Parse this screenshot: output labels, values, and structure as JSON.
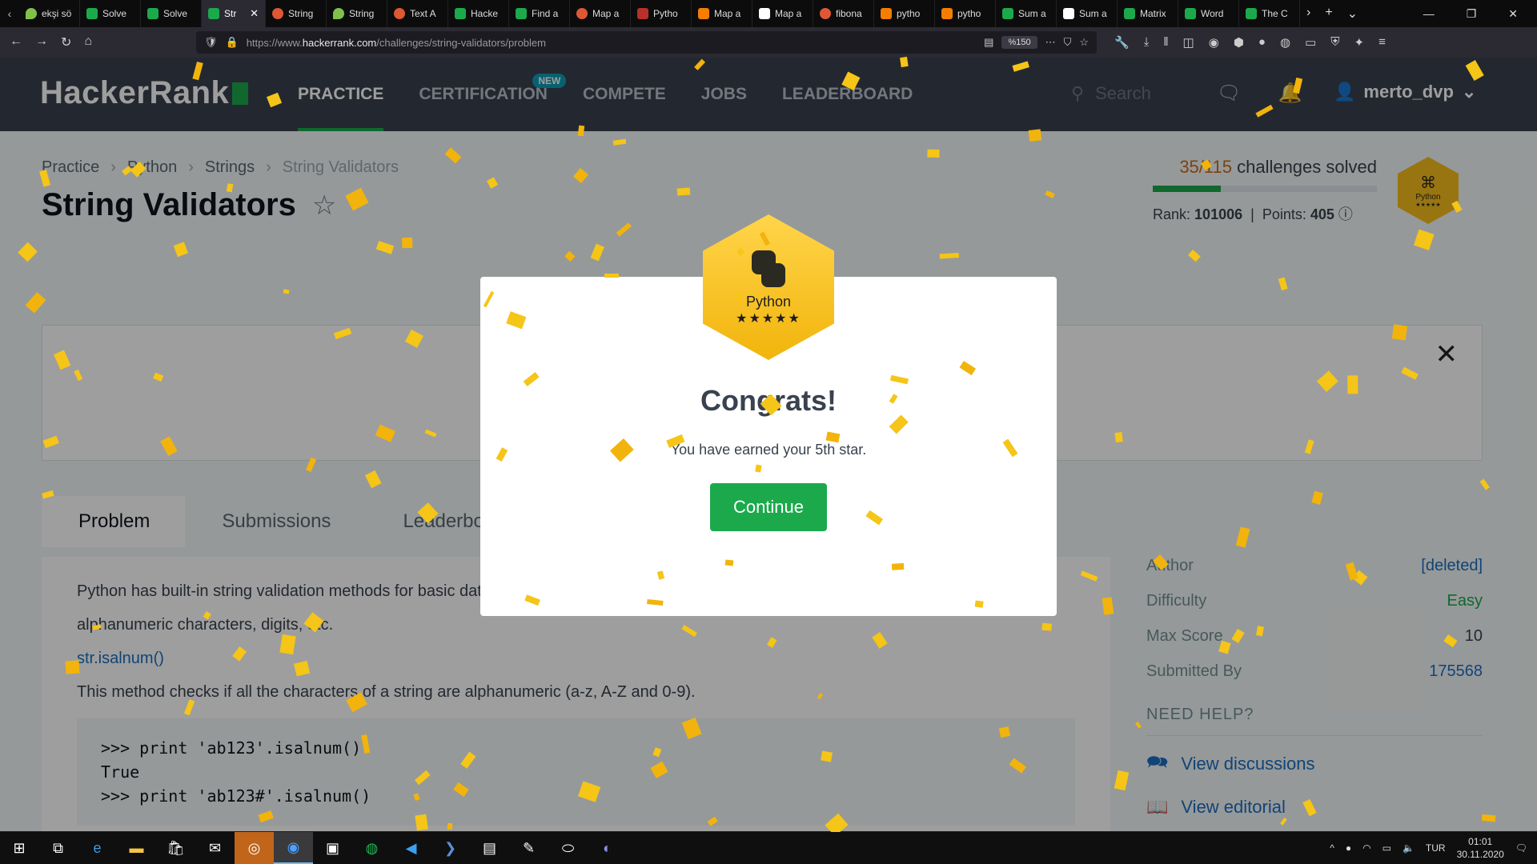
{
  "browser": {
    "tabs": [
      {
        "title": "ekşi sö",
        "icon": "ek"
      },
      {
        "title": "Solve",
        "icon": "hr"
      },
      {
        "title": "Solve",
        "icon": "hr"
      },
      {
        "title": "Str",
        "icon": "hr",
        "active": true
      },
      {
        "title": "String",
        "icon": "dd"
      },
      {
        "title": "String",
        "icon": "ek"
      },
      {
        "title": "Text A",
        "icon": "dd"
      },
      {
        "title": "Hacke",
        "icon": "hr"
      },
      {
        "title": "Find a",
        "icon": "hr"
      },
      {
        "title": "Map a",
        "icon": "dd"
      },
      {
        "title": "Pytho",
        "icon": "rd"
      },
      {
        "title": "Map a",
        "icon": "bl"
      },
      {
        "title": "Map a",
        "icon": "wh"
      },
      {
        "title": "fibona",
        "icon": "dd"
      },
      {
        "title": "pytho",
        "icon": "bl"
      },
      {
        "title": "pytho",
        "icon": "bl"
      },
      {
        "title": "Sum a",
        "icon": "hr"
      },
      {
        "title": "Sum a",
        "icon": "wh"
      },
      {
        "title": "Matrix",
        "icon": "hr"
      },
      {
        "title": "Word",
        "icon": "hr"
      },
      {
        "title": "The C",
        "icon": "hr"
      }
    ],
    "url_prefix": "https://www.",
    "url_domain": "hackerrank.com",
    "url_path": "/challenges/string-validators/problem",
    "zoom": "%150"
  },
  "header": {
    "logo": "HackerRank",
    "nav": [
      "PRACTICE",
      "CERTIFICATION",
      "COMPETE",
      "JOBS",
      "LEADERBOARD"
    ],
    "new_badge": "NEW",
    "search_placeholder": "Search",
    "username": "merto_dvp"
  },
  "breadcrumb": [
    "Practice",
    "Python",
    "Strings",
    "String Validators"
  ],
  "title": "String Validators",
  "stats": {
    "solved_count": "35/115",
    "solved_label": "challenges solved",
    "progress": 0.304,
    "rank_label": "Rank:",
    "rank": "101006",
    "points_label": "Points:",
    "points": "405",
    "badge_name": "Python",
    "badge_stars": "★★★★★"
  },
  "tabs": [
    "Problem",
    "Submissions",
    "Leaderboard"
  ],
  "problem": {
    "intro_1": "Python has built-in string validation methods for basic data. It can check if a string is composed of",
    "intro_2": "alphanumeric characters, digits, etc.",
    "method": "str.isalnum()",
    "method_desc": "This method checks if all the characters of a string are alphanumeric (a-z, A-Z and 0-9).",
    "code": [
      ">>> print 'ab123'.isalnum()",
      "True",
      ">>> print 'ab123#'.isalnum()"
    ]
  },
  "sidebar": {
    "rows": [
      {
        "label": "Author",
        "value": "[deleted]",
        "style": "blue"
      },
      {
        "label": "Difficulty",
        "value": "Easy",
        "style": "green"
      },
      {
        "label": "Max Score",
        "value": "10",
        "style": ""
      },
      {
        "label": "Submitted By",
        "value": "175568",
        "style": "blue"
      }
    ],
    "need_help": "NEED HELP?",
    "links": [
      "View discussions",
      "View editorial"
    ]
  },
  "modal": {
    "badge_name": "Python",
    "badge_stars": "★★★★★",
    "heading": "Congrats!",
    "message": "You have earned your 5th star.",
    "button": "Continue"
  },
  "taskbar": {
    "language": "TUR",
    "time": "01:01",
    "date": "30.11.2020"
  },
  "colors": {
    "brand_green": "#1ba94c",
    "header_bg": "#39424e",
    "confetti": "#f5c518",
    "badge_gold": "#f5bd1a"
  }
}
